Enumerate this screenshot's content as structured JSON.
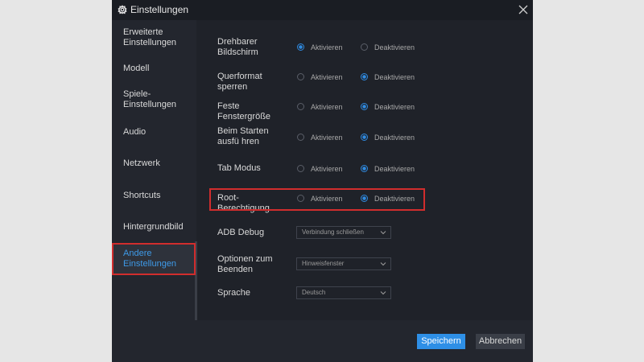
{
  "window": {
    "title": "Einstellungen",
    "icons": {
      "settings": "gear-icon",
      "close": "close-icon"
    }
  },
  "sidebar": {
    "items": [
      {
        "label": "Erweiterte Einstellungen",
        "active": false
      },
      {
        "label": "Modell",
        "active": false
      },
      {
        "label": "Spiele-Einstellungen",
        "active": false
      },
      {
        "label": "Audio",
        "active": false
      },
      {
        "label": "Netzwerk",
        "active": false
      },
      {
        "label": "Shortcuts",
        "active": false
      },
      {
        "label": "Hintergrundbild",
        "active": false
      },
      {
        "label": "Andere Einstellungen",
        "active": true
      }
    ]
  },
  "settings": {
    "radio_options": {
      "on": "Aktivieren",
      "off": "Deaktivieren"
    },
    "rows": [
      {
        "label": "Drehbarer Bildschirm",
        "selected": "on"
      },
      {
        "label": "Querformat sperren",
        "selected": "off"
      },
      {
        "label": "Feste Fenstergröße",
        "selected": "off"
      },
      {
        "label": "Beim Starten ausfü hren",
        "selected": "off"
      },
      {
        "label": "Tab Modus",
        "selected": "off"
      },
      {
        "label": "Root-Berechtigung",
        "selected": "off"
      }
    ],
    "selects": [
      {
        "label": "ADB Debug",
        "value": "Verbindung schließen"
      },
      {
        "label": "Optionen zum Beenden",
        "value": "Hinweisfenster"
      },
      {
        "label": "Sprache",
        "value": "Deutsch"
      }
    ]
  },
  "footer": {
    "save_label": "Speichern",
    "cancel_label": "Abbrechen"
  },
  "colors": {
    "accent": "#2e8fe6",
    "highlight": "#d12d2d",
    "background": "#1f2229"
  }
}
